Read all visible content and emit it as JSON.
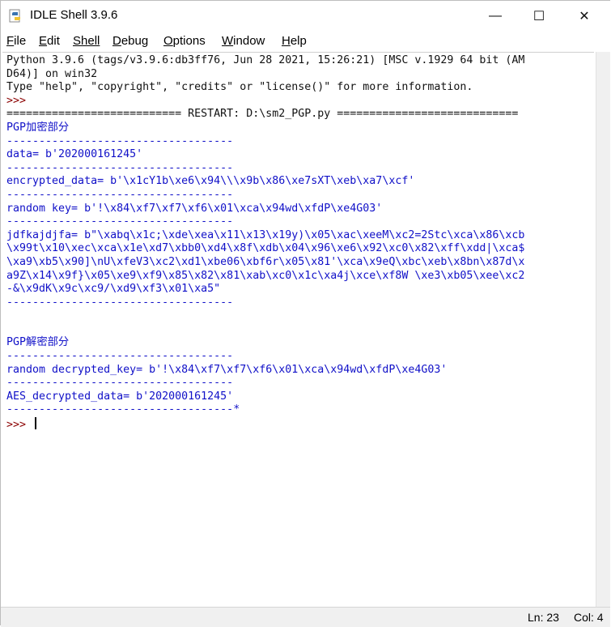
{
  "window": {
    "title": "IDLE Shell 3.9.6"
  },
  "titlebar": {
    "minimize_glyph": "—",
    "maximize_glyph": "☐",
    "close_glyph": "✕"
  },
  "menubar": {
    "items": [
      {
        "label": "File",
        "key": "F"
      },
      {
        "label": "Edit",
        "key": "E"
      },
      {
        "label": "Shell",
        "key": "S"
      },
      {
        "label": "Debug",
        "key": "D"
      },
      {
        "label": "Options",
        "key": "O"
      },
      {
        "label": "Window",
        "key": "W"
      },
      {
        "label": "Help",
        "key": "H"
      }
    ]
  },
  "shell": {
    "lines": [
      {
        "text": "Python 3.9.6 (tags/v3.9.6:db3ff76, Jun 28 2021, 15:26:21) [MSC v.1929 64 bit (AM",
        "kind": "sysout"
      },
      {
        "text": "D64)] on win32",
        "kind": "sysout"
      },
      {
        "text": "Type \"help\", \"copyright\", \"credits\" or \"license()\" for more information.",
        "kind": "sysout"
      },
      {
        "text": ">>> ",
        "kind": "prompt"
      },
      {
        "text": "=========================== RESTART: D:\\sm2_PGP.py ============================",
        "kind": "sysout"
      },
      {
        "text": "PGP加密部分",
        "kind": "out"
      },
      {
        "text": "-----------------------------------",
        "kind": "out"
      },
      {
        "text": "data= b'202000161245'",
        "kind": "out"
      },
      {
        "text": "-----------------------------------",
        "kind": "out"
      },
      {
        "text": "encrypted_data= b'\\x1cY1b\\xe6\\x94\\\\\\x9b\\x86\\xe7sXT\\xeb\\xa7\\xcf'",
        "kind": "out"
      },
      {
        "text": "-----------------------------------",
        "kind": "out"
      },
      {
        "text": "random key= b'!\\x84\\xf7\\xf7\\xf6\\x01\\xca\\x94wd\\xfdP\\xe4G03'",
        "kind": "out"
      },
      {
        "text": "-----------------------------------",
        "kind": "out"
      },
      {
        "text": "jdfkajdjfa= b\"\\xabq\\x1c;\\xde\\xea\\x11\\x13\\x19y)\\x05\\xac\\xeeM\\xc2=2Stc\\xca\\x86\\xcb",
        "kind": "out"
      },
      {
        "text": "\\x99t\\x10\\xec\\xca\\x1e\\xd7\\xbb0\\xd4\\x8f\\xdb\\x04\\x96\\xe6\\x92\\xc0\\x82\\xff\\xdd|\\xca$",
        "kind": "out"
      },
      {
        "text": "\\xa9\\xb5\\x90]\\nU\\xfeV3\\xc2\\xd1\\xbe06\\xbf6r\\x05\\x81'\\xca\\x9eQ\\xbc\\xeb\\x8bn\\x87d\\x",
        "kind": "out"
      },
      {
        "text": "a9Z\\x14\\x9f}\\x05\\xe9\\xf9\\x85\\x82\\x81\\xab\\xc0\\x1c\\xa4j\\xce\\xf8W \\xe3\\xb05\\xee\\xc2",
        "kind": "out"
      },
      {
        "text": "-&\\x9dK\\x9c\\xc9/\\xd9\\xf3\\x01\\xa5\"",
        "kind": "out"
      },
      {
        "text": "-----------------------------------",
        "kind": "out"
      },
      {
        "text": "",
        "kind": "out"
      },
      {
        "text": "",
        "kind": "out"
      },
      {
        "text": "PGP解密部分",
        "kind": "out"
      },
      {
        "text": "-----------------------------------",
        "kind": "out"
      },
      {
        "text": "random decrypted_key= b'!\\x84\\xf7\\xf7\\xf6\\x01\\xca\\x94wd\\xfdP\\xe4G03'",
        "kind": "out"
      },
      {
        "text": "-----------------------------------",
        "kind": "out"
      },
      {
        "text": "AES_decrypted_data= b'202000161245'",
        "kind": "out"
      },
      {
        "text": "-----------------------------------*",
        "kind": "out"
      }
    ],
    "current_prompt": ">>> "
  },
  "statusbar": {
    "line": "Ln: 23",
    "col": "Col: 4"
  },
  "colors": {
    "stdout": "#1010c8",
    "prompt": "#8b0000",
    "text": "#111111"
  }
}
